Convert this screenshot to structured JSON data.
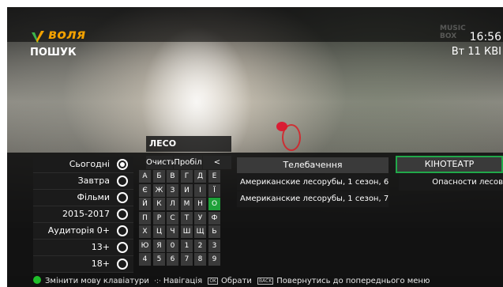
{
  "header": {
    "brand": "воля",
    "page_title": "ПОШУК",
    "channel_logo": "MUSIC BOX",
    "time": "16:56",
    "date": "Вт 11 КВІ"
  },
  "search": {
    "query": "ЛЕСО"
  },
  "filters": [
    {
      "label": "Сьогодні",
      "selected": true
    },
    {
      "label": "Завтра",
      "selected": false
    },
    {
      "label": "Фільми",
      "selected": false
    },
    {
      "label": "2015-2017",
      "selected": false
    },
    {
      "label": "Аудиторія 0+",
      "selected": false
    },
    {
      "label": "13+",
      "selected": false
    },
    {
      "label": "18+",
      "selected": false
    }
  ],
  "keyboard": {
    "clear": "Очисти",
    "space": "Пробіл",
    "backspace": "<",
    "rows": [
      [
        "А",
        "Б",
        "В",
        "Г",
        "Д",
        "Е"
      ],
      [
        "Є",
        "Ж",
        "З",
        "И",
        "І",
        "Ї"
      ],
      [
        "Й",
        "К",
        "Л",
        "М",
        "Н",
        "О"
      ],
      [
        "П",
        "Р",
        "С",
        "Т",
        "У",
        "Ф"
      ],
      [
        "Х",
        "Ц",
        "Ч",
        "Ш",
        "Щ",
        "Ь"
      ],
      [
        "Ю",
        "Я",
        "0",
        "1",
        "2",
        "3"
      ],
      [
        "4",
        "5",
        "6",
        "7",
        "8",
        "9"
      ]
    ],
    "selected_key": "О"
  },
  "results": {
    "tv": {
      "header": "Телебачення",
      "items": [
        "Американские лесорубы, 1 сезон, 6...",
        "Американские лесорубы, 1 сезон, 7..."
      ]
    },
    "cinema": {
      "header": "КІНОТЕАТР",
      "items": [
        "Опасности лесов"
      ]
    }
  },
  "footer": {
    "change_lang": "Змінити мову клавіатури",
    "navigate": "Навігація",
    "ok_key": "OK",
    "select": "Обрати",
    "back_key": "BACK",
    "back": "Повернутись до попереднього меню"
  },
  "colors": {
    "accent_green": "#21a84a",
    "brand_orange": "#f2a100",
    "selected_key": "#1fa13a"
  }
}
